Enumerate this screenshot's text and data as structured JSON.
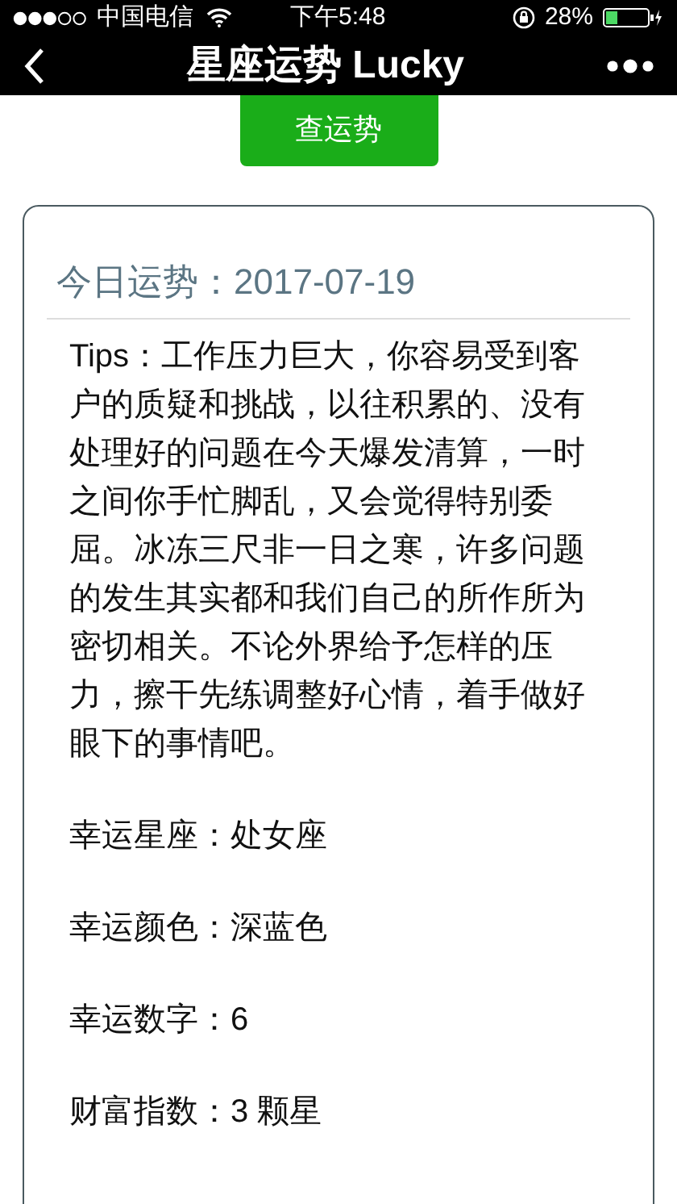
{
  "status_bar": {
    "carrier": "中国电信",
    "time": "下午5:48",
    "battery": "28%"
  },
  "nav": {
    "title": "星座运势 Lucky"
  },
  "query_button": "查运势",
  "card": {
    "title": "今日运势：2017-07-19",
    "tips": "Tips：工作压力巨大，你容易受到客户的质疑和挑战，以往积累的、没有处理好的问题在今天爆发清算，一时之间你手忙脚乱，又会觉得特别委屈。冰冻三尺非一日之寒，许多问题的发生其实都和我们自己的所作所为密切相关。不论外界给予怎样的压力，擦干先练调整好心情，着手做好眼下的事情吧。",
    "items": [
      "幸运星座：处女座",
      "幸运颜色：深蓝色",
      "幸运数字：6",
      "财富指数：3 颗星"
    ]
  }
}
